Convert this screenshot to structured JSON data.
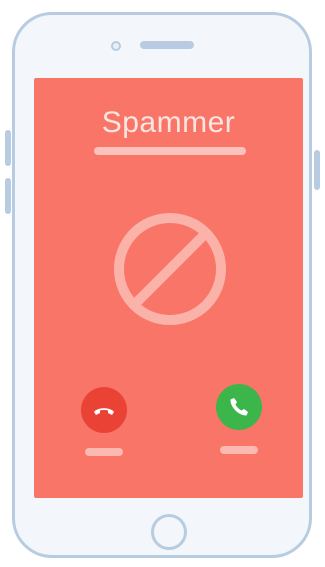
{
  "caller": {
    "name": "Spammer"
  },
  "icons": {
    "block": "block-icon",
    "decline": "phone-hangup-icon",
    "accept": "phone-icon"
  },
  "colors": {
    "screen": "#f87567",
    "decline": "#ea4335",
    "accept": "#3cb54a",
    "phone_frame": "#b7cce0"
  }
}
